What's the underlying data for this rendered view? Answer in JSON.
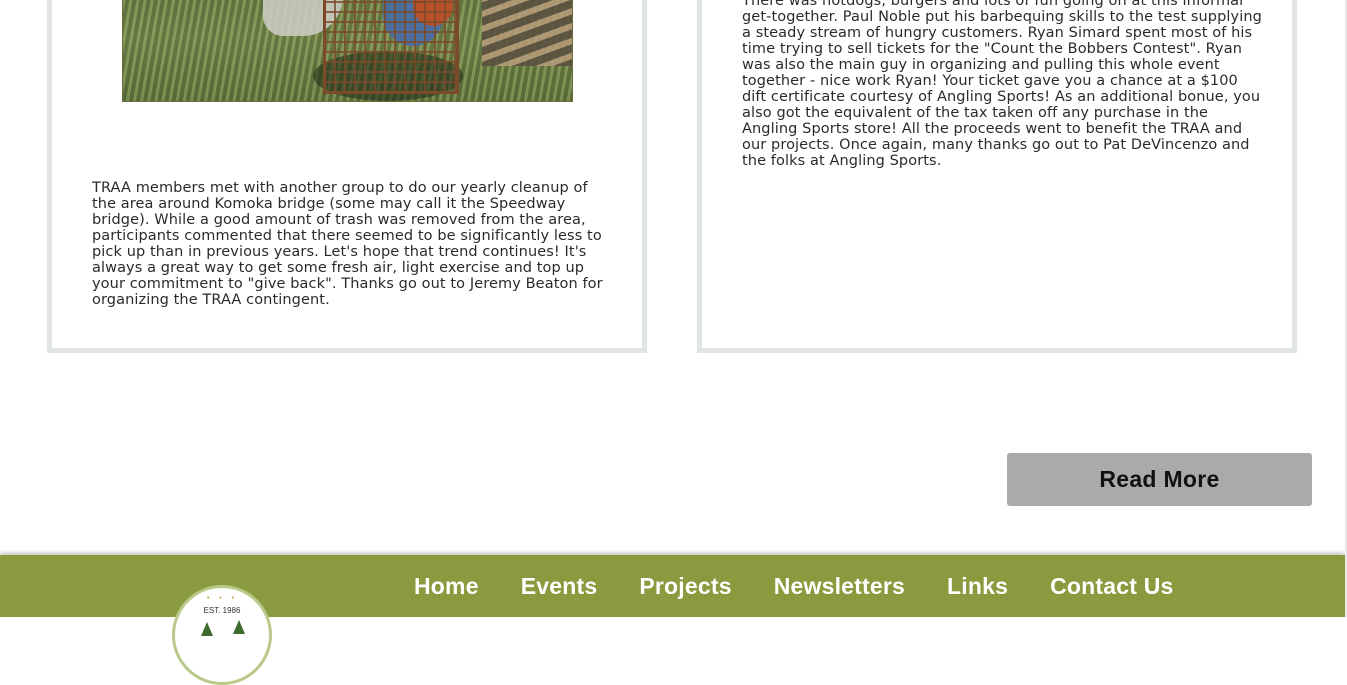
{
  "left_card": {
    "photo_alt": "",
    "text": "TRAA members met with another group to do our yearly cleanup of the area around Komoka bridge (some may call it the Speedway bridge). While a good amount of trash was removed from the area, participants commented that there seemed to be significantly less to pick up than in previous years. Let's hope that trend continues! It's always a great way to get some fresh air, light exercise and top up your commitment to \"give back\". Thanks go out to Jeremy Beaton for organizing the TRAA contingent."
  },
  "right_card": {
    "text": "There was hotdogs, burgers and lots of fun going on at this informal get-together. Paul Noble put his barbequing skills to the test supplying a steady stream of hungry customers. Ryan Simard spent most of his time trying to sell tickets for the \"Count the Bobbers Contest\". Ryan was also the main guy in organizing and pulling this whole event together - nice work Ryan! Your ticket gave you a chance at a $100 dift certificate courtesy of Angling Sports! As an additional bonue, you also got the equivalent of the tax taken off any purchase in the Angling Sports store! All the proceeds went to benefit the TRAA and our projects. Once again, many thanks go out to Pat DeVincenzo and the folks at Angling Sports."
  },
  "read_more_label": "Read More",
  "footer": {
    "nav": [
      "Home",
      "Events",
      "Projects",
      "Newsletters",
      "Links",
      "Contact Us"
    ],
    "logo_text": "EST. 1986",
    "logo_dots": "• • •"
  },
  "colors": {
    "footer_bg": "#8a9a3e",
    "card_border": "#e0e5e4",
    "button_bg": "#aaaaaa"
  }
}
